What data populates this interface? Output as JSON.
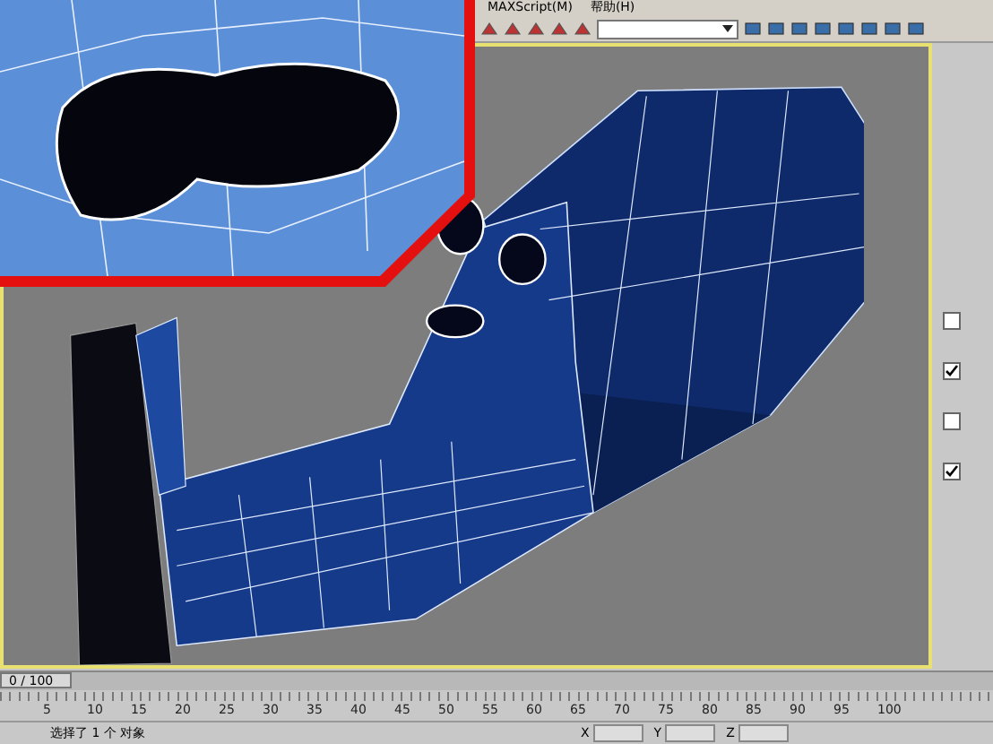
{
  "menu": [
    {
      "label": "MAXScript(M)"
    },
    {
      "label": "帮助(H)"
    }
  ],
  "command_panel": {
    "checkboxes": [
      {
        "checked": false
      },
      {
        "checked": true
      },
      {
        "checked": false
      },
      {
        "checked": true
      }
    ]
  },
  "timeline": {
    "frame_counter": "0 / 100",
    "level": 0,
    "ruler_labels": [
      "5",
      "10",
      "15",
      "20",
      "25",
      "30",
      "35",
      "40",
      "45",
      "50",
      "55",
      "60",
      "65",
      "70",
      "75",
      "80",
      "85",
      "90",
      "95",
      "100"
    ]
  },
  "status_bar": {
    "message": "选择了 1 个 对象",
    "coords": [
      {
        "axis": "X"
      },
      {
        "axis": "Y"
      },
      {
        "axis": "Z"
      }
    ]
  }
}
